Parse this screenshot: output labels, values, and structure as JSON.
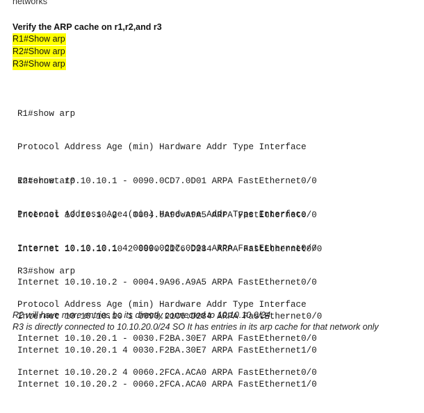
{
  "top_fragment": "networks",
  "heading": "Verify the ARP cache on r1,r2,and r3",
  "commands": [
    "R1#Show arp",
    "R2#Show arp",
    "R3#Show arp"
  ],
  "outputs": [
    {
      "prompt": "R1#show arp",
      "header": "Protocol Address Age (min) Hardware Addr Type Interface",
      "rows": [
        "Internet 10.10.10.1 - 0090.0CD7.0D01 ARPA FastEthernet0/0",
        "Internet 10.10.10.2 4 0004.9A96.A9A5 ARPA FastEthernet0/0",
        "Internet 10.10.10.10 2 0090.21C6.D284 ARPA FastEthernet0/0"
      ]
    },
    {
      "prompt": "R2#show arp",
      "header": "Protocol Address Age (min) Hardware Addr Type Interface",
      "rows": [
        "Internet 10.10.10.1 4 0090.0CD7.0D01 ARPA FastEthernet0/0",
        "Internet 10.10.10.2 - 0004.9A96.A9A5 ARPA FastEthernet0/0",
        "Internet 10.10.10.10 1 0090.21C6.D284 ARPA FastEthernet0/0",
        "Internet 10.10.20.1 4 0030.F2BA.30E7 ARPA FastEthernet1/0",
        "Internet 10.10.20.2 - 0060.2FCA.ACA0 ARPA FastEthernet1/0"
      ]
    },
    {
      "prompt": "R3#show arp",
      "header": "Protocol Address Age (min) Hardware Addr Type Interface",
      "rows": [
        "Internet 10.10.20.1 - 0030.F2BA.30E7 ARPA FastEthernet0/0",
        "Internet 10.10.20.2 4 0060.2FCA.ACA0 ARPA FastEthernet0/0"
      ]
    }
  ],
  "notes": [
    "R2 will have more entries bc its directly connected to 10.10.10.0/24",
    "R3 is directly connected to 10.10.20.0/24 SO It has entries in its arp cache for that network only"
  ]
}
